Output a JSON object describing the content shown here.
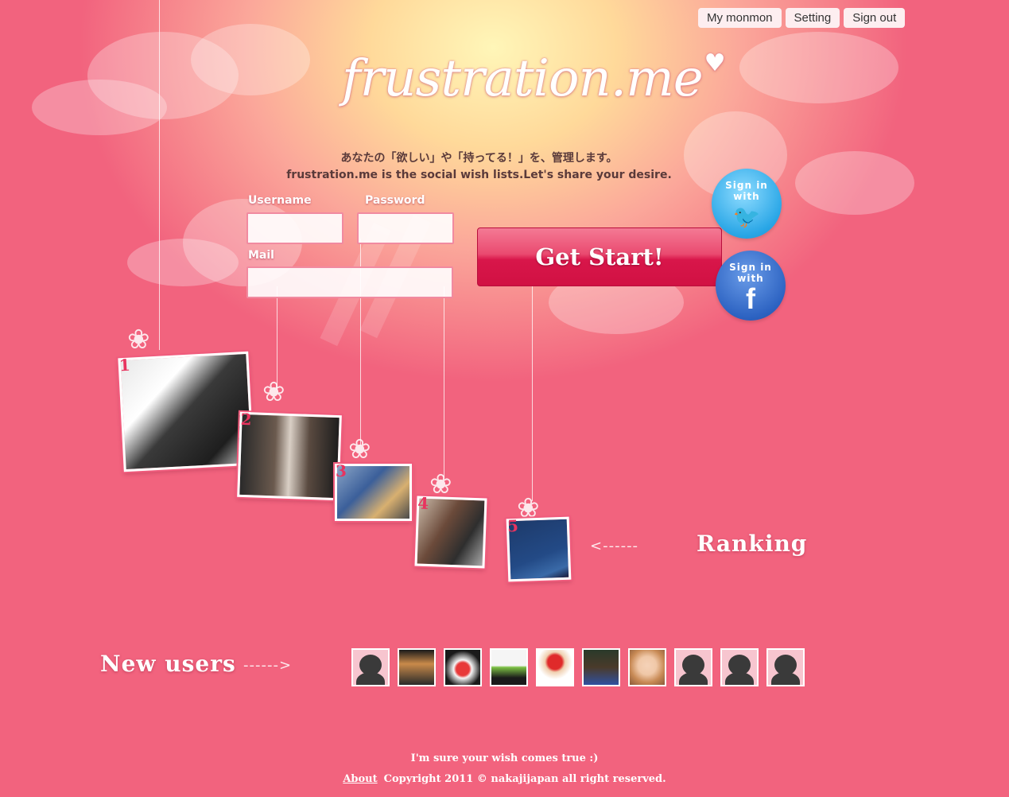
{
  "nav": {
    "items": [
      {
        "label": "My monmon"
      },
      {
        "label": "Setting"
      },
      {
        "label": "Sign out"
      }
    ]
  },
  "brand": {
    "logo_text": "frustration.me",
    "heart": "♥"
  },
  "intro": {
    "tagline_jp": "あなたの「欲しい」や「持ってる！」を、管理します。",
    "tagline_en": "frustration.me is the social wish lists.Let's share your desire."
  },
  "form": {
    "username_label": "Username",
    "password_label": "Password",
    "mail_label": "Mail",
    "username_value": "",
    "password_value": "",
    "mail_value": "",
    "submit_label": "Get Start!"
  },
  "social": {
    "twitter": {
      "label": "Sign in with",
      "icon": "twitter-bird-icon",
      "color": "#29a6e6"
    },
    "facebook": {
      "label": "Sign in with",
      "icon": "facebook-f-icon",
      "color": "#2d63c2"
    }
  },
  "ranking": {
    "title": "Ranking",
    "items": [
      {
        "rank": "1",
        "image": "camera-photo"
      },
      {
        "rank": "2",
        "image": "album-cover-chemistry"
      },
      {
        "rank": "3",
        "image": "figure-box-photo"
      },
      {
        "rank": "4",
        "image": "album-cover-speedland"
      },
      {
        "rank": "5",
        "image": "album-cover-night"
      }
    ]
  },
  "new_users": {
    "title": "New users",
    "avatars": [
      "default",
      "photo",
      "photo",
      "photo",
      "photo",
      "photo",
      "photo",
      "default",
      "default",
      "default"
    ]
  },
  "footer": {
    "slogan": "I'm sure your wish comes true :)",
    "about_link": "About",
    "copyright": "Copyright 2011 © nakajijapan all right reserved."
  },
  "colors": {
    "background": "#f2637e",
    "glow": "#fff6b8",
    "primary_button": "#d8164a"
  }
}
